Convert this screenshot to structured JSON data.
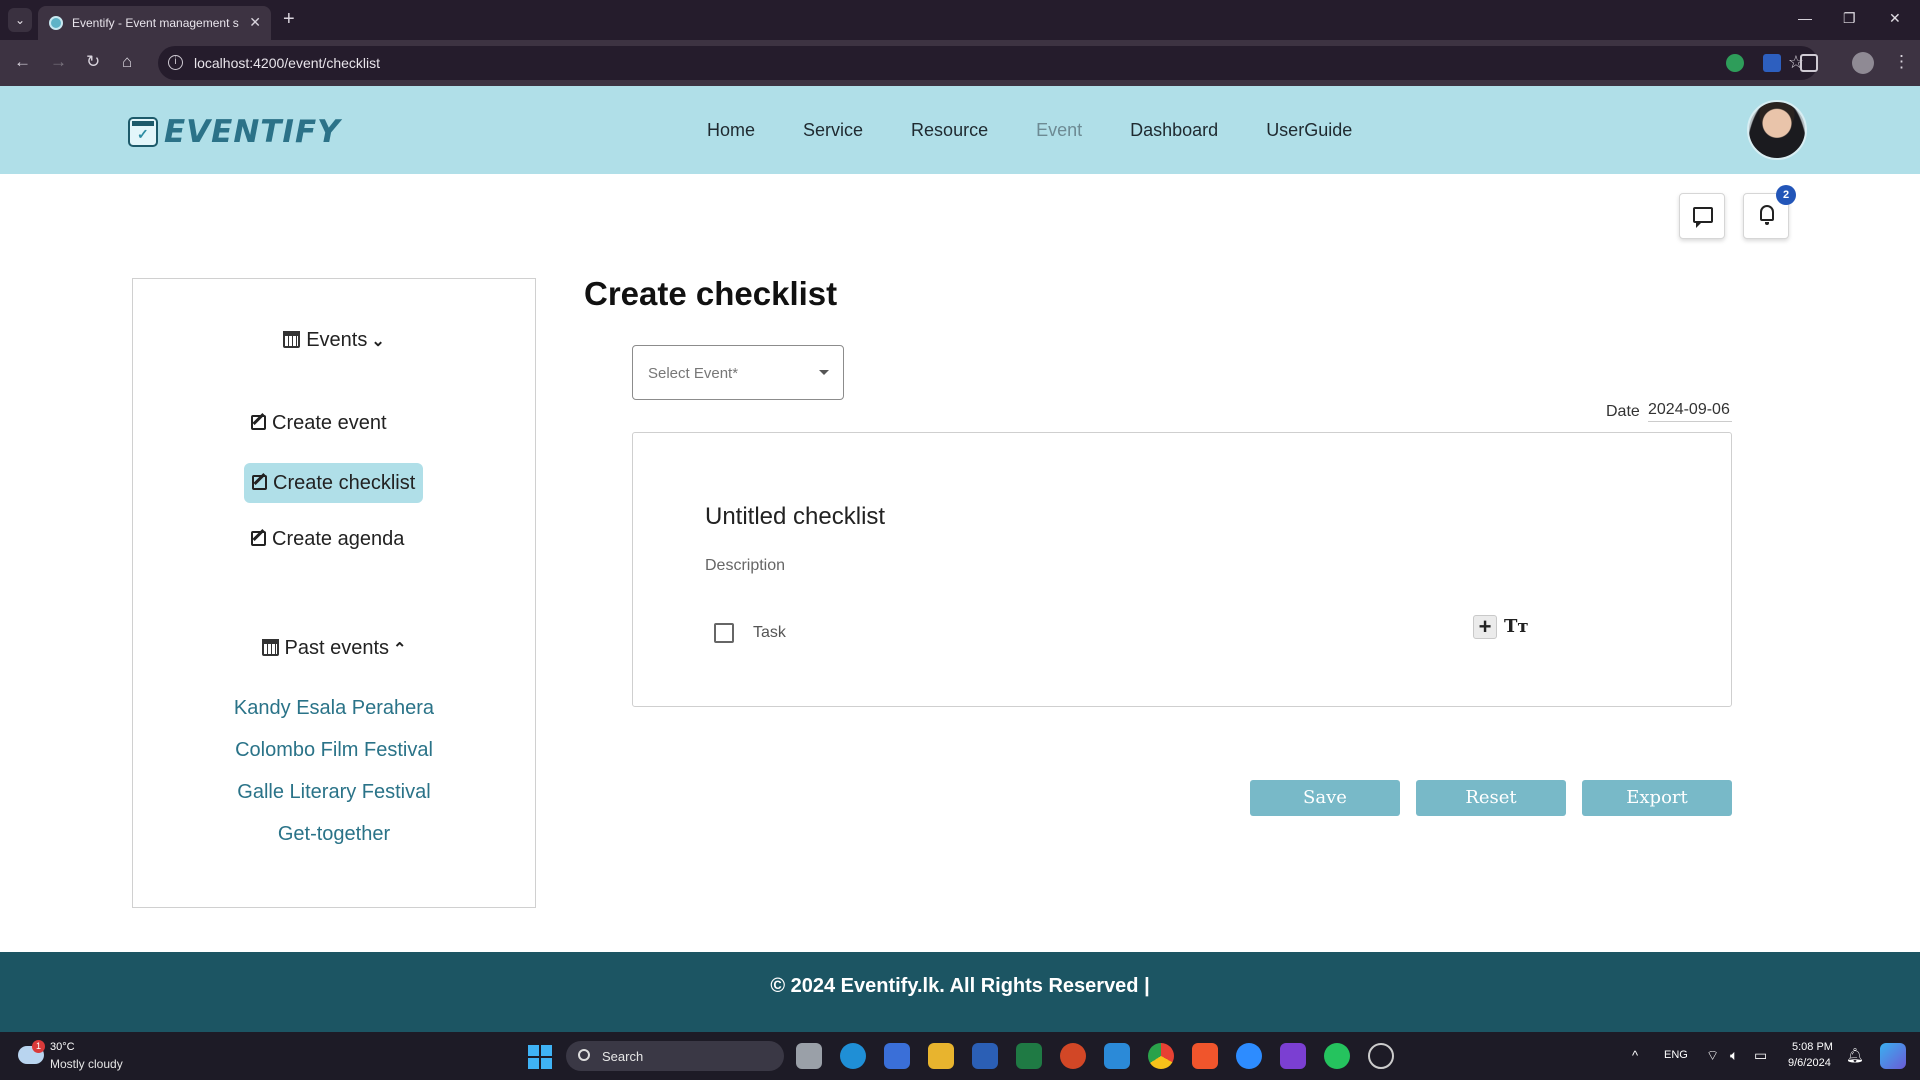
{
  "browser": {
    "tab_title": "Eventify - Event management s",
    "url": "localhost:4200/event/checklist",
    "icons": [
      "tab-list-icon",
      "close-icon",
      "plus-icon",
      "back-icon",
      "forward-icon",
      "reload-icon",
      "home-icon",
      "info-icon",
      "star-icon",
      "minimize-icon",
      "restore-icon",
      "window-close-icon"
    ]
  },
  "header": {
    "logo_text": "EVENTIFY",
    "nav": [
      {
        "label": "Home",
        "active": false
      },
      {
        "label": "Service",
        "active": false
      },
      {
        "label": "Resource",
        "active": false
      },
      {
        "label": "Event",
        "active": true
      },
      {
        "label": "Dashboard",
        "active": false
      },
      {
        "label": "UserGuide",
        "active": false
      }
    ]
  },
  "actions": {
    "notification_count": "2",
    "icons": [
      "chat-icon",
      "bell-icon"
    ]
  },
  "sidebar": {
    "events_heading": "Events",
    "items": [
      {
        "label": "Create event",
        "active": false
      },
      {
        "label": "Create checklist",
        "active": true
      },
      {
        "label": "Create agenda",
        "active": false
      }
    ],
    "past_heading": "Past events",
    "past_events": [
      "Kandy Esala Perahera",
      "Colombo Film Festival",
      "Galle Literary Festival",
      "Get-together"
    ]
  },
  "main": {
    "title": "Create checklist",
    "select_placeholder": "Select Event*",
    "date_label": "Date",
    "date_value": "2024-09-06",
    "checklist": {
      "title": "Untitled checklist",
      "description": "Description",
      "task_label": "Task",
      "add_symbol": "+",
      "text_symbol": "Tт"
    },
    "buttons": {
      "save": "Save",
      "reset": "Reset",
      "export": "Export"
    }
  },
  "footer": {
    "text": "© 2024 Eventify.lk. All Rights Reserved |"
  },
  "taskbar": {
    "weather_temp": "30°C",
    "weather_desc": "Mostly cloudy",
    "weather_badge": "1",
    "search_label": "Search",
    "lang": "ENG",
    "time": "5:08 PM",
    "date": "9/6/2024"
  },
  "colors": {
    "header_bg": "#b0dfe8",
    "accent": "#78b9c8",
    "footer_bg": "#1c5563",
    "link": "#2a7388"
  }
}
